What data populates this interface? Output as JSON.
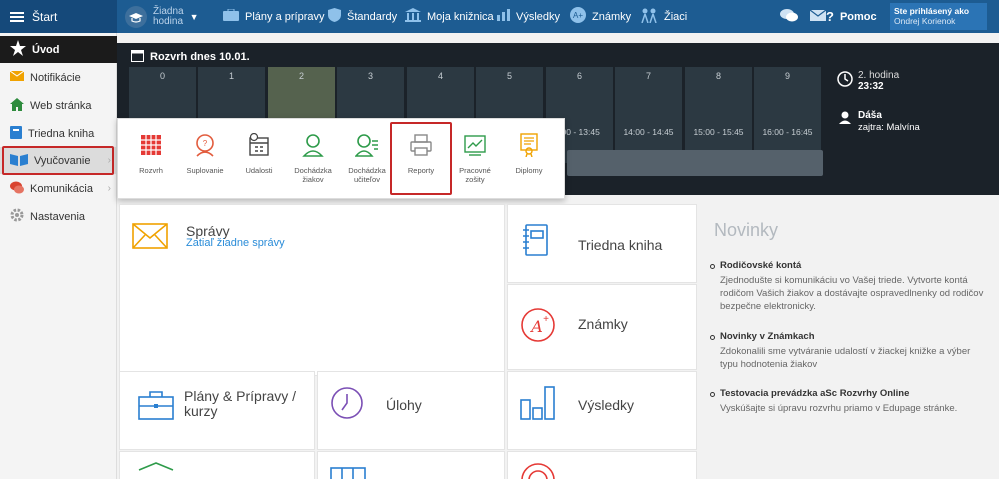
{
  "topbar": {
    "start_label": "Štart",
    "lesson_line1": "Žiadna",
    "lesson_line2": "hodina",
    "items": [
      "Plány a prípravy",
      "Štandardy",
      "Moja knižnica",
      "Výsledky",
      "Známky",
      "Žiaci"
    ],
    "help_label": "Pomoc",
    "user_line1": "Ste prihlásený ako",
    "user_line2": "Ondrej Korienok"
  },
  "sidebar": {
    "items": [
      {
        "label": "Úvod",
        "icon": "star-icon"
      },
      {
        "label": "Notifikácie",
        "icon": "envelope-icon"
      },
      {
        "label": "Web stránka",
        "icon": "home-icon"
      },
      {
        "label": "Triedna kniha",
        "icon": "book-icon"
      },
      {
        "label": "Vyučovanie",
        "icon": "open-book-icon"
      },
      {
        "label": "Komunikácia",
        "icon": "chat-icon"
      },
      {
        "label": "Nastavenia",
        "icon": "gear-icon"
      }
    ]
  },
  "timetable": {
    "title": "Rozvrh dnes 10.01.",
    "periods": [
      "0",
      "1",
      "2",
      "3",
      "4",
      "5",
      "6",
      "7",
      "8",
      "9"
    ],
    "times": [
      "",
      "",
      "",
      "",
      "",
      "",
      ":00 - 13:45",
      "14:00 - 14:45",
      "15:00 - 15:45",
      "16:00 - 16:45"
    ],
    "current_label": "2. hodina",
    "current_time": "23:32",
    "duty_name": "Dáša",
    "duty_info": "zajtra: Malvína"
  },
  "popup": {
    "items": [
      {
        "label": "Rozvrh",
        "icon": "grid-icon"
      },
      {
        "label": "Suplovanie",
        "icon": "substitute-icon"
      },
      {
        "label": "Udalosti",
        "icon": "calendar-clock-icon"
      },
      {
        "label": "Dochádzka žiakov",
        "icon": "student-attendance-icon"
      },
      {
        "label": "Dochádzka učiteľov",
        "icon": "teacher-attendance-icon"
      },
      {
        "label": "Reporty",
        "icon": "printer-icon"
      },
      {
        "label": "Pracovné zošity",
        "icon": "workbook-icon"
      },
      {
        "label": "Diplomy",
        "icon": "diploma-icon"
      }
    ]
  },
  "tiles": {
    "spravy_title": "Správy",
    "spravy_sub": "Zatiaľ žiadne správy",
    "triedna_kniha": "Triedna kniha",
    "znamky": "Známky",
    "plany_title": "Plány & Prípravy / kurzy",
    "ulohy": "Úlohy",
    "vysledky": "Výsledky"
  },
  "news": {
    "title": "Novinky",
    "items": [
      {
        "head": "Rodičovské kontá",
        "body": "Zjednodušte si komunikáciu vo Vašej triede. Vytvorte kontá rodičom Vašich žiakov a dostávajte ospravedlnenky od rodičov bezpečne elektronicky."
      },
      {
        "head": "Novinky v Známkach",
        "body": "Zdokonalili sme vytváranie udalostí v žiackej knižke a výber typu hodnotenia žiakov"
      },
      {
        "head": "Testovacia prevádzka aSc Rozvrhy Online",
        "body": "Vyskúšajte si úpravu rozvrhu priamo v Edupage stránke."
      }
    ]
  },
  "colors": {
    "topbar": "#1d5c92",
    "highlight": "#c62828",
    "accent_blue": "#2a8cd8",
    "timetable_bg": "#1b2229"
  }
}
